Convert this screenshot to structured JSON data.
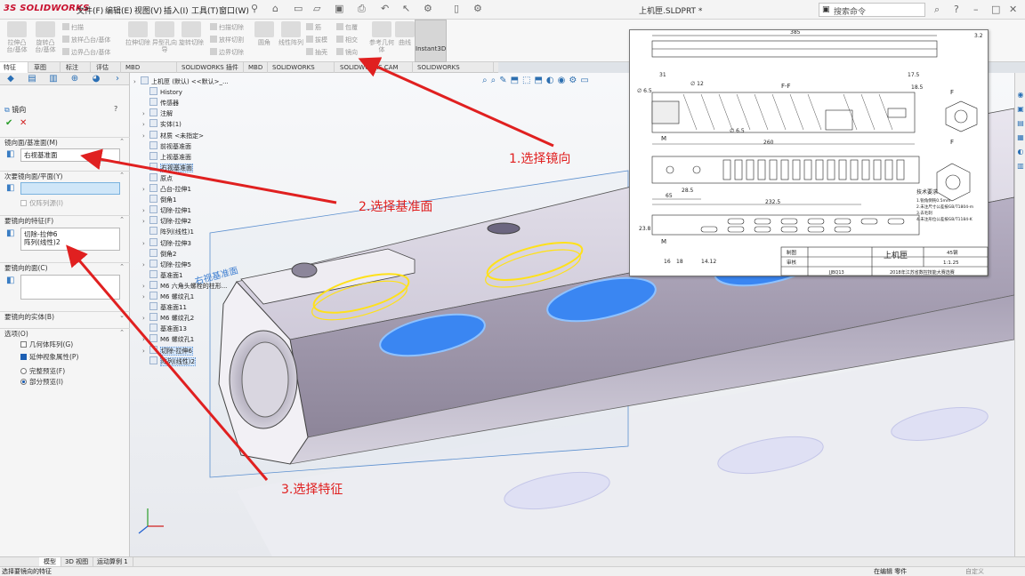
{
  "app": {
    "brand_prefix": "3S",
    "brand_name": "SOLIDWORKS",
    "document_title": "上机匣.SLDPRT *",
    "search_placeholder": "搜索命令",
    "menus": [
      "文件(F)",
      "编辑(E)",
      "视图(V)",
      "插入(I)",
      "工具(T)",
      "窗口(W)"
    ]
  },
  "ribbon": {
    "big_buttons": [
      "拉伸凸台/基体",
      "旋转凸台/基体",
      "拉伸切除",
      "异型孔向导",
      "旋转切除",
      "圆角",
      "线性阵列",
      "筋",
      "参考几何体",
      "曲线",
      "Instant3D"
    ],
    "small_buttons": [
      "扫描",
      "放样凸台/基体",
      "边界凸台/基体",
      "扫描切除",
      "放样切割",
      "边界切除",
      "拔模",
      "包覆",
      "抽壳",
      "相交",
      "镜向"
    ]
  },
  "tabs": [
    "特征",
    "草图",
    "标注",
    "评估",
    "MBD Dimensions",
    "SOLIDWORKS 插件",
    "MBD",
    "SOLIDWORKS CAM",
    "SOLIDWORKS CAM TBM",
    "SOLIDWORKS Inspection"
  ],
  "property_manager": {
    "title": "镜向",
    "help_icon": "?",
    "ok_icon": "✔",
    "cancel_icon": "✕",
    "sections": {
      "mirror_face": {
        "title": "镜向面/基准面(M)",
        "value": "右视基准面"
      },
      "secondary_face": {
        "title": "次要镜向面/平面(Y)",
        "value": "",
        "checkbox_label": "仅阵列源(I)"
      },
      "features": {
        "title": "要镜向的特征(F)",
        "items": [
          "切除-拉伸6",
          "阵列(线性)2"
        ]
      },
      "faces": {
        "title": "要镜向的面(C)"
      },
      "bodies": {
        "title": "要镜向的实体(B)"
      },
      "options": {
        "title": "选项(O)",
        "geometry_pattern": "几何体阵列(G)",
        "propagate_visual": "延伸视象属性(P)",
        "full_preview": "完整预览(F)",
        "partial_preview": "部分预览(I)"
      }
    }
  },
  "feature_tree": [
    "上机匣 (默认) <<默认>_...",
    "History",
    "传感器",
    "注解",
    "实体(1)",
    "材质 <未指定>",
    "前视基准面",
    "上视基准面",
    "右视基准面",
    "原点",
    "凸台-拉伸1",
    "倒角1",
    "切除-拉伸1",
    "切除-拉伸2",
    "阵列(线性)1",
    "切除-拉伸3",
    "倒角2",
    "切除-拉伸5",
    "基准面1",
    "M6 六角头螺栓的柱形...",
    "M6 螺纹孔1",
    "基准面11",
    "M6 螺纹孔2",
    "基准面13",
    "M6 螺纹孔1",
    "切除-拉伸6",
    "阵列(线性)2"
  ],
  "viewport": {
    "plane_label": "右视基准面"
  },
  "drawing": {
    "title_block": {
      "part_name": "上机匣",
      "material": "45钢",
      "scale": "1:1.25",
      "drawing_no": "JJBQ13",
      "competition": "2018年江苏省数控技能大赛选赛",
      "designer_label": "制图",
      "checker_label": "审核"
    },
    "dimensions": [
      "385",
      "260",
      "232.5",
      "65",
      "28.5",
      "31",
      "17.5",
      "18.5",
      "∅ 6.5",
      "∅ 12",
      "∅ 6.5",
      "F-F",
      "M",
      "M",
      "F",
      "F",
      "23.8",
      "16",
      "18",
      "14.12",
      "3.2"
    ],
    "notes_title": "技术要求",
    "notes": [
      "1.锐角倒钝0.5mm",
      "2.未注尺寸公差按GB/T1804-m",
      "3.去毛刺",
      "4.未注形位公差按GB/T1184-K"
    ]
  },
  "bottom_tabs": [
    "模型",
    "3D 视图",
    "运动算例 1"
  ],
  "status": {
    "left": "选择要镜向的特征",
    "right": "在编辑 零件",
    "units": "自定义"
  },
  "annotations": {
    "step1": "1.选择镜向",
    "step2": "2.选择基准面",
    "step3": "3.选择特征"
  }
}
